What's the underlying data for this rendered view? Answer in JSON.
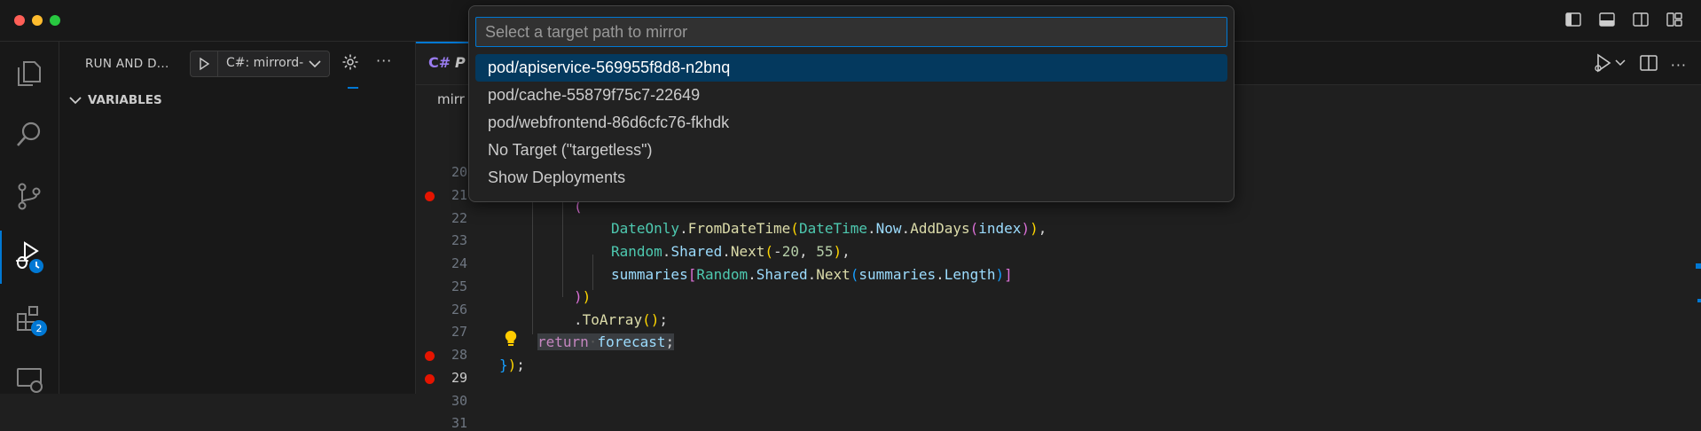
{
  "sidebar": {
    "title": "RUN AND D...",
    "config_name": "C#: mirrord-",
    "more_label": "···",
    "variables_label": "VARIABLES"
  },
  "activity_bar": {
    "extensions_badge": "2"
  },
  "editor": {
    "tab_lang_icon": "C#",
    "tab_name": "P",
    "breadcrumb": "mirr",
    "line_numbers": [
      "20",
      "21",
      "22",
      "23",
      "24",
      "25",
      "26",
      "27",
      "28",
      "29",
      "30",
      "31"
    ],
    "current_line": "29",
    "breakpoint_lines": [
      "21",
      "28",
      "29"
    ]
  },
  "quick_pick": {
    "placeholder": "Select a target path to mirror",
    "items": [
      "pod/apiservice-569955f8d8-n2bnq",
      "pod/cache-55879f75c7-22649",
      "pod/webfrontend-86d6cfc76-fkhdk",
      "No Target (\"targetless\")",
      "Show Deployments"
    ],
    "selected_index": 0
  },
  "colors": {
    "accent": "#0078d4",
    "breakpoint": "#e51400",
    "selection": "#04395e"
  }
}
